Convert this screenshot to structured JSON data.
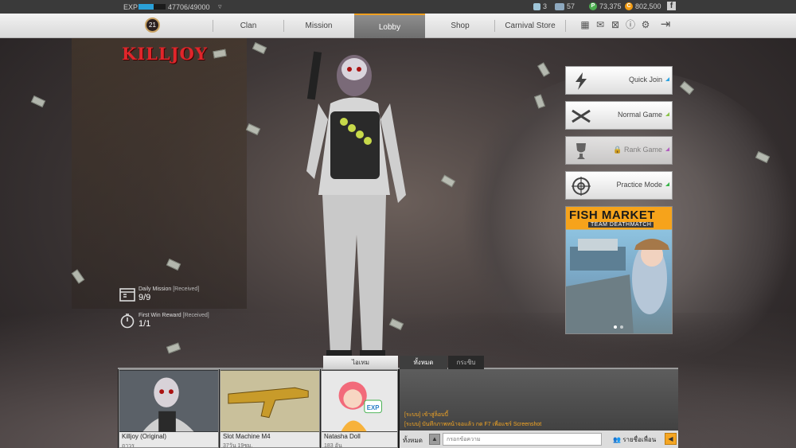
{
  "statusbar": {
    "exp_label": "EXP",
    "exp_value": "47706/49000",
    "exp_progress": 0.55,
    "stats": [
      {
        "icon": "key-icon",
        "value": "3"
      },
      {
        "icon": "inventory-icon",
        "value": "57"
      },
      {
        "icon": "p-coin-icon",
        "value": "73,375"
      },
      {
        "icon": "c-coin-icon",
        "value": "802,500"
      }
    ],
    "facebook_label": "f"
  },
  "navbar": {
    "level": "21",
    "items": [
      {
        "label": "Clan"
      },
      {
        "label": "Mission"
      },
      {
        "label": "Lobby"
      },
      {
        "label": "Shop"
      },
      {
        "label": "Carnival Store"
      }
    ],
    "active": "Lobby",
    "icons": [
      "calendar-icon",
      "mail-icon",
      "gift-icon",
      "info-icon",
      "gear-icon",
      "exit-icon"
    ]
  },
  "title": "KILLJOY",
  "modes": [
    {
      "label": "Quick Join",
      "icon": "lightning-icon",
      "corner": "#2fa3e0"
    },
    {
      "label": "Normal Game",
      "icon": "crossed-guns-icon",
      "corner": "#8bc34a"
    },
    {
      "label": "Rank Game",
      "icon": "trophy-icon",
      "corner": "#c45fd6",
      "locked": true
    },
    {
      "label": "Practice Mode",
      "icon": "target-icon",
      "corner": "#39b54a"
    }
  ],
  "banner": {
    "title": "FISH MARKET",
    "subtitle": "TEAM DEATHMATCH"
  },
  "missions": [
    {
      "title": "Daily Mission",
      "status": "[Received]",
      "value": "9/9",
      "icon": "calendar-mission-icon"
    },
    {
      "title": "First Win Reward",
      "status": "[Received]",
      "value": "1/1",
      "icon": "stopwatch-icon"
    }
  ],
  "bottom": {
    "item_tab": "ไอเทม",
    "chat_tabs": [
      {
        "label": "ทั้งหมด",
        "active": true
      },
      {
        "label": "กระซิบ",
        "active": false
      }
    ],
    "cards": [
      {
        "name": "Killjoy (Original)",
        "sub": "ถาวร"
      },
      {
        "name": "Slot Machine M4",
        "sub": "37วัน 19ชม."
      },
      {
        "name": "Natasha Doll",
        "sub": "183 อัน"
      }
    ],
    "chat_lines": [
      "[ระบบ] เข้าสู่ล็อบบี้",
      "[ระบบ] บันทึกภาพหน้าจอแล้ว กด F7 เพื่อแชร์ Screenshot"
    ],
    "chat_channel": "ทั้งหมด",
    "chat_placeholder": "กรอกข้อความ",
    "friend_label": "รายชื่อเพื่อน"
  }
}
